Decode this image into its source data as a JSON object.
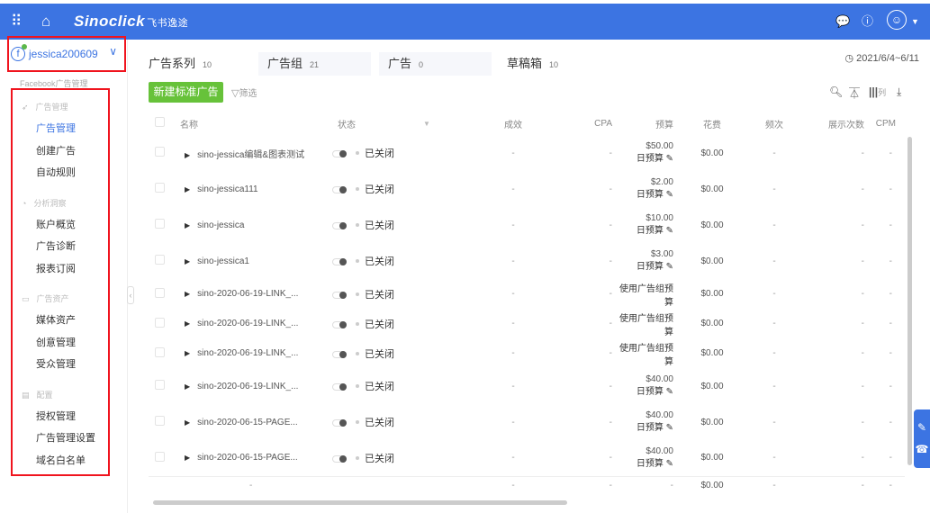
{
  "header": {
    "logo": "Sinoclick",
    "logo_cn": "飞书逸途",
    "icons": [
      "apps-grid-icon",
      "home-icon",
      "wechat-icon",
      "help-icon",
      "user-avatar-icon",
      "caret-down-icon"
    ]
  },
  "sidebar": {
    "account": "jessica200609",
    "section_label": "Facebook广告管理",
    "groups": [
      {
        "label": "广告管理",
        "icon": "paper-plane-icon",
        "items": [
          "广告管理",
          "创建广告",
          "自动规则"
        ]
      },
      {
        "label": "分析洞察",
        "icon": "chart-icon",
        "items": [
          "账户概览",
          "广告诊断",
          "报表订阅"
        ]
      },
      {
        "label": "广告资产",
        "icon": "folder-icon",
        "items": [
          "媒体资产",
          "创意管理",
          "受众管理"
        ]
      },
      {
        "label": "配置",
        "icon": "settings-icon",
        "items": [
          "授权管理",
          "广告管理设置",
          "域名白名单"
        ]
      }
    ],
    "active": "广告管理"
  },
  "tabs": [
    {
      "label": "广告系列",
      "count": "10"
    },
    {
      "label": "广告组",
      "count": "21"
    },
    {
      "label": "广告",
      "count": "0"
    },
    {
      "label": "草稿箱",
      "count": "10"
    }
  ],
  "toolbar": {
    "new_button": "新建标准广告",
    "filter": "筛选",
    "date_range": "2021/6/4~6/11",
    "columns": "列"
  },
  "table": {
    "headers": {
      "name": "名称",
      "status": "状态",
      "results": "成效",
      "cpa": "CPA",
      "budget": "预算",
      "spend": "花费",
      "frequency": "频次",
      "impressions": "展示次数",
      "cpm": "CPM"
    },
    "rows": [
      {
        "name": "sino-jessica编辑&图表测试",
        "status": "已关闭",
        "results": "-",
        "cpa": "-",
        "budget": "$50.00",
        "budget_type": "日预算",
        "spend": "$0.00",
        "frequency": "-",
        "impressions": "-",
        "cpm": "-"
      },
      {
        "name": "sino-jessica111",
        "status": "已关闭",
        "results": "-",
        "cpa": "-",
        "budget": "$2.00",
        "budget_type": "日预算",
        "spend": "$0.00",
        "frequency": "-",
        "impressions": "-",
        "cpm": "-"
      },
      {
        "name": "sino-jessica",
        "status": "已关闭",
        "results": "-",
        "cpa": "-",
        "budget": "$10.00",
        "budget_type": "日预算",
        "spend": "$0.00",
        "frequency": "-",
        "impressions": "-",
        "cpm": "-"
      },
      {
        "name": "sino-jessica1",
        "status": "已关闭",
        "results": "-",
        "cpa": "-",
        "budget": "$3.00",
        "budget_type": "日预算",
        "spend": "$0.00",
        "frequency": "-",
        "impressions": "-",
        "cpm": "-"
      },
      {
        "name": "sino-2020-06-19-LINK_...",
        "status": "已关闭",
        "results": "-",
        "cpa": "-",
        "budget": "使用广告组预算",
        "budget_type": "",
        "spend": "$0.00",
        "frequency": "-",
        "impressions": "-",
        "cpm": "-"
      },
      {
        "name": "sino-2020-06-19-LINK_...",
        "status": "已关闭",
        "results": "-",
        "cpa": "-",
        "budget": "使用广告组预算",
        "budget_type": "",
        "spend": "$0.00",
        "frequency": "-",
        "impressions": "-",
        "cpm": "-"
      },
      {
        "name": "sino-2020-06-19-LINK_...",
        "status": "已关闭",
        "results": "-",
        "cpa": "-",
        "budget": "使用广告组预算",
        "budget_type": "",
        "spend": "$0.00",
        "frequency": "-",
        "impressions": "-",
        "cpm": "-"
      },
      {
        "name": "sino-2020-06-19-LINK_...",
        "status": "已关闭",
        "results": "-",
        "cpa": "-",
        "budget": "$40.00",
        "budget_type": "日预算",
        "spend": "$0.00",
        "frequency": "-",
        "impressions": "-",
        "cpm": "-"
      },
      {
        "name": "sino-2020-06-15-PAGE...",
        "status": "已关闭",
        "results": "-",
        "cpa": "-",
        "budget": "$40.00",
        "budget_type": "日预算",
        "spend": "$0.00",
        "frequency": "-",
        "impressions": "-",
        "cpm": "-"
      },
      {
        "name": "sino-2020-06-15-PAGE...",
        "status": "已关闭",
        "results": "-",
        "cpa": "-",
        "budget": "$40.00",
        "budget_type": "日预算",
        "spend": "$0.00",
        "frequency": "-",
        "impressions": "-",
        "cpm": "-"
      }
    ],
    "total": {
      "name": "-",
      "results": "-",
      "cpa": "-",
      "budget": "-",
      "spend": "$0.00",
      "frequency": "-",
      "impressions": "-",
      "cpm": "-"
    }
  },
  "colors": {
    "header": "#3c74e2",
    "primary_button": "#67c23a",
    "highlight_box": "#f0141e"
  }
}
